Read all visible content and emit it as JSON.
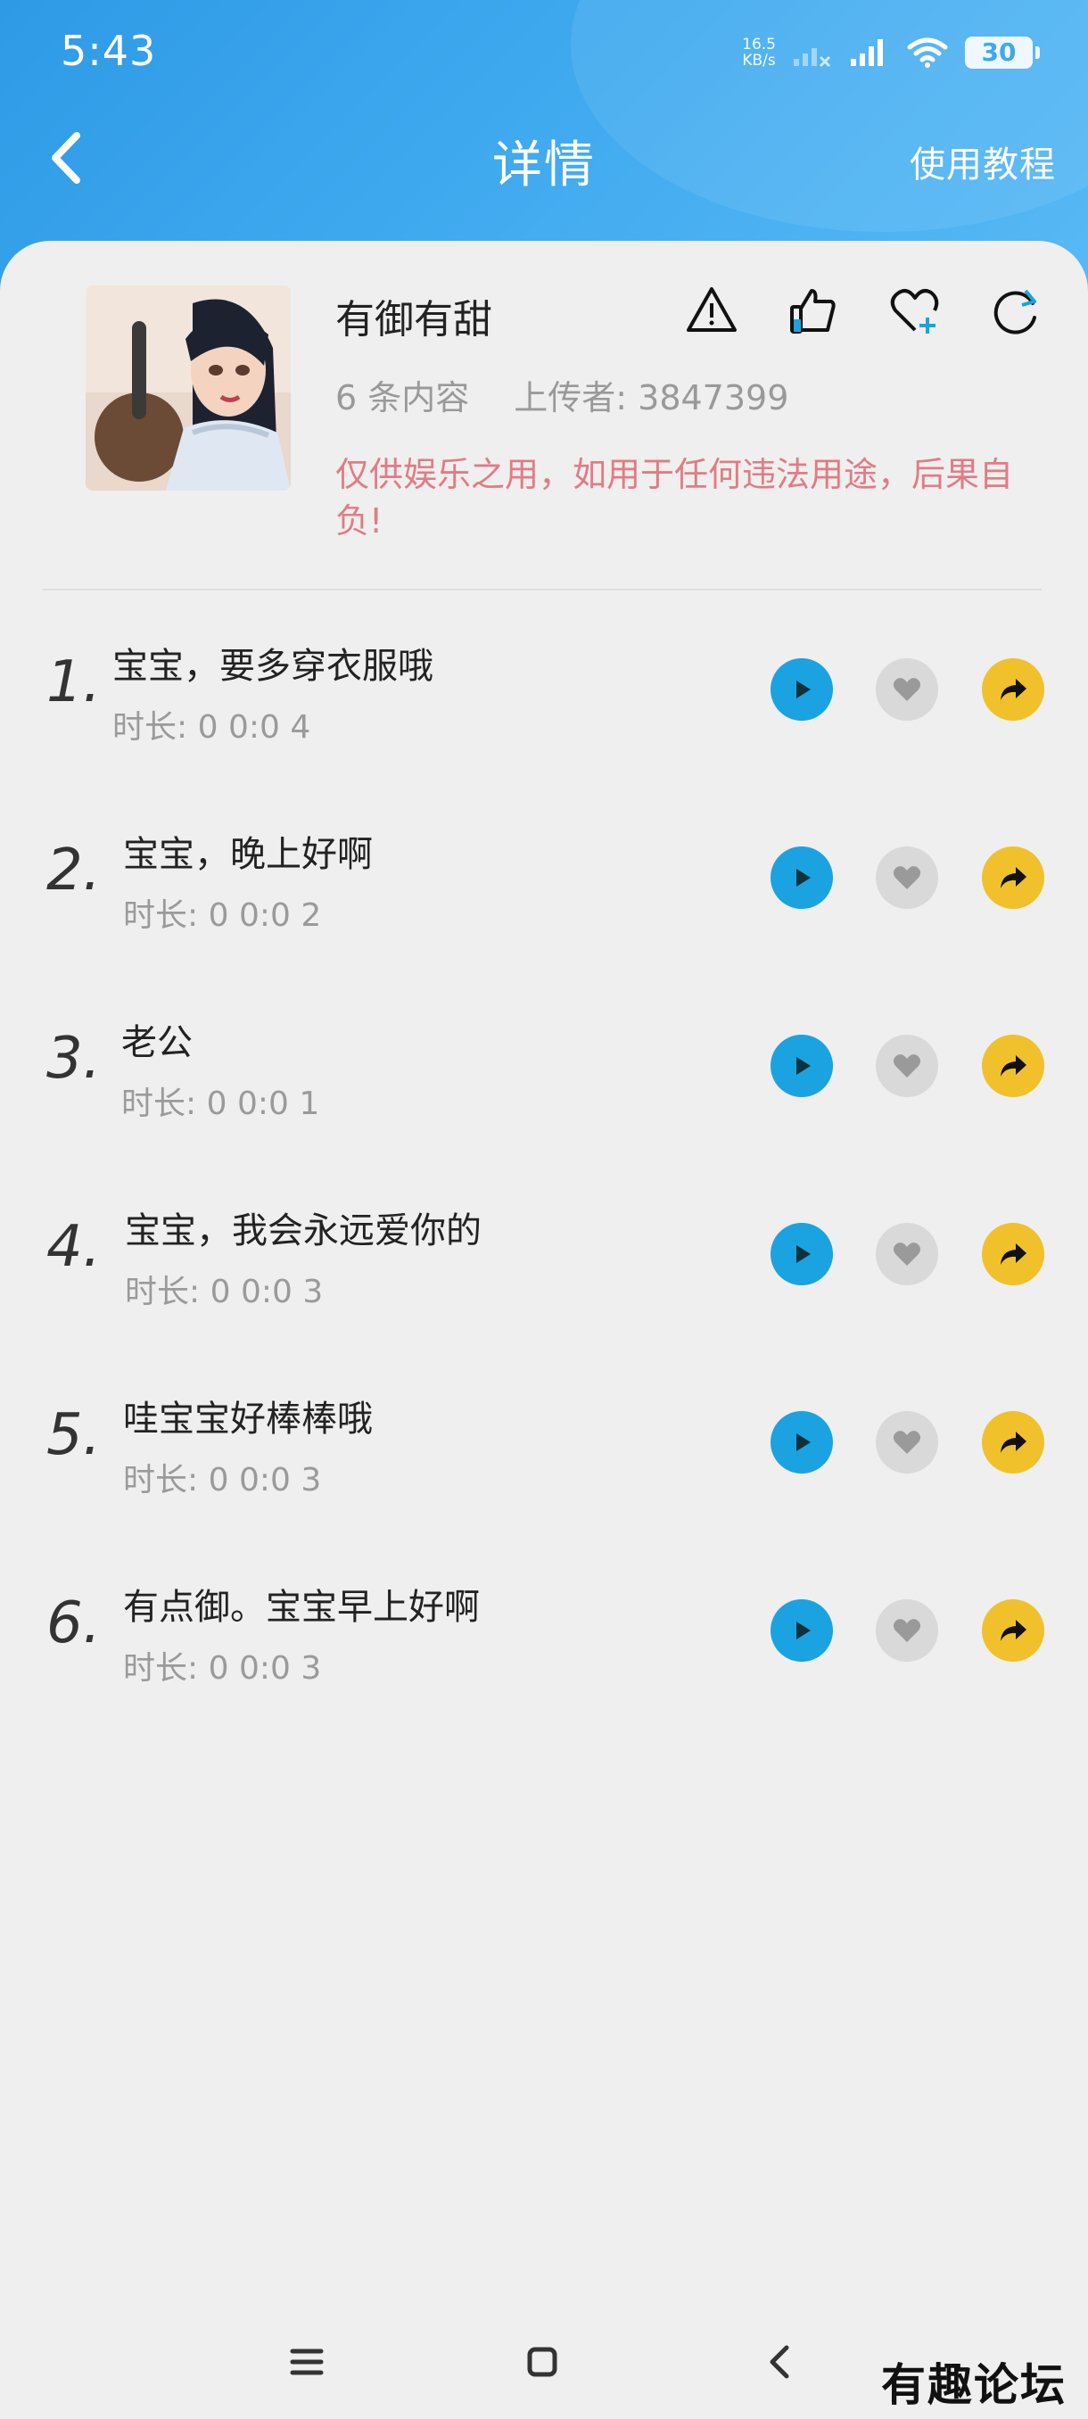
{
  "status_bar": {
    "time": "5:43",
    "net_speed_value": "16.5",
    "net_speed_unit": "KB/s",
    "battery": "30"
  },
  "nav": {
    "title": "详情",
    "tutorial": "使用教程"
  },
  "profile": {
    "name": "有御有甜",
    "count": "6 条内容",
    "uploader": "上传者: 3847399",
    "disclaimer": "仅供娱乐之用，如用于任何违法用途，后果自负!"
  },
  "duration_label": "时长:",
  "items": [
    {
      "num": "1.",
      "title": "宝宝，要多穿衣服哦",
      "duration": "0 0:0 4"
    },
    {
      "num": "2.",
      "title": "宝宝，晚上好啊",
      "duration": "0 0:0 2"
    },
    {
      "num": "3.",
      "title": "老公",
      "duration": "0 0:0 1"
    },
    {
      "num": "4.",
      "title": "宝宝，我会永远爱你的",
      "duration": "0 0:0 3"
    },
    {
      "num": "5.",
      "title": "哇宝宝好棒棒哦",
      "duration": "0 0:0 3"
    },
    {
      "num": "6.",
      "title": "有点御。宝宝早上好啊",
      "duration": "0 0:0 3"
    }
  ],
  "colors": {
    "header": "#3fa9ef",
    "play": "#1aa3e0",
    "like": "#d9d9d9",
    "share": "#f0c12b",
    "disclaimer": "#e07c86"
  },
  "watermark": "有趣论坛"
}
